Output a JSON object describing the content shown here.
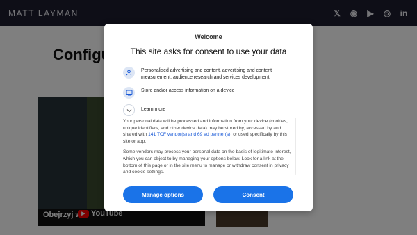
{
  "site": {
    "brand": "MATT LAYMAN",
    "social_icons": [
      "x-icon",
      "github-icon",
      "youtube-icon",
      "discord-icon",
      "linkedin-icon"
    ],
    "social_glyphs": [
      "𝕏",
      "◉",
      "▶",
      "◎",
      "in"
    ],
    "page_title": "Configu",
    "video": {
      "label": "Obejrzyj w",
      "platform": "YouTube"
    }
  },
  "consent": {
    "heading": "Welcome",
    "title": "This site asks for consent to use your data",
    "purposes": [
      {
        "icon": "person-icon",
        "glyph": "👤",
        "text": "Personalised advertising and content, advertising and content measurement, audience research and services development"
      },
      {
        "icon": "device-icon",
        "glyph": "▭",
        "text": "Store and/or access information on a device"
      }
    ],
    "learn_more": {
      "icon": "chevron-down-icon",
      "glyph": "⌄",
      "text": "Learn more"
    },
    "paragraph1_pre": "Your personal data will be processed and information from your device (cookies, unique identifiers, and other device data) may be stored by, accessed by and shared with ",
    "paragraph1_link": "141 TCF vendor(s) and 69 ad partner(s)",
    "paragraph1_post": ", or used specifically by this site or app.",
    "paragraph2": "Some vendors may process your personal data on the basis of legitimate interest, which you can object to by managing your options below. Look for a link at the bottom of this page or in the site menu to manage or withdraw consent in privacy and cookie settings.",
    "manage_label": "Manage options",
    "consent_label": "Consent"
  },
  "colors": {
    "accent": "#1a73e8",
    "link": "#1a5ad7",
    "topbar": "#1c1c2e"
  }
}
